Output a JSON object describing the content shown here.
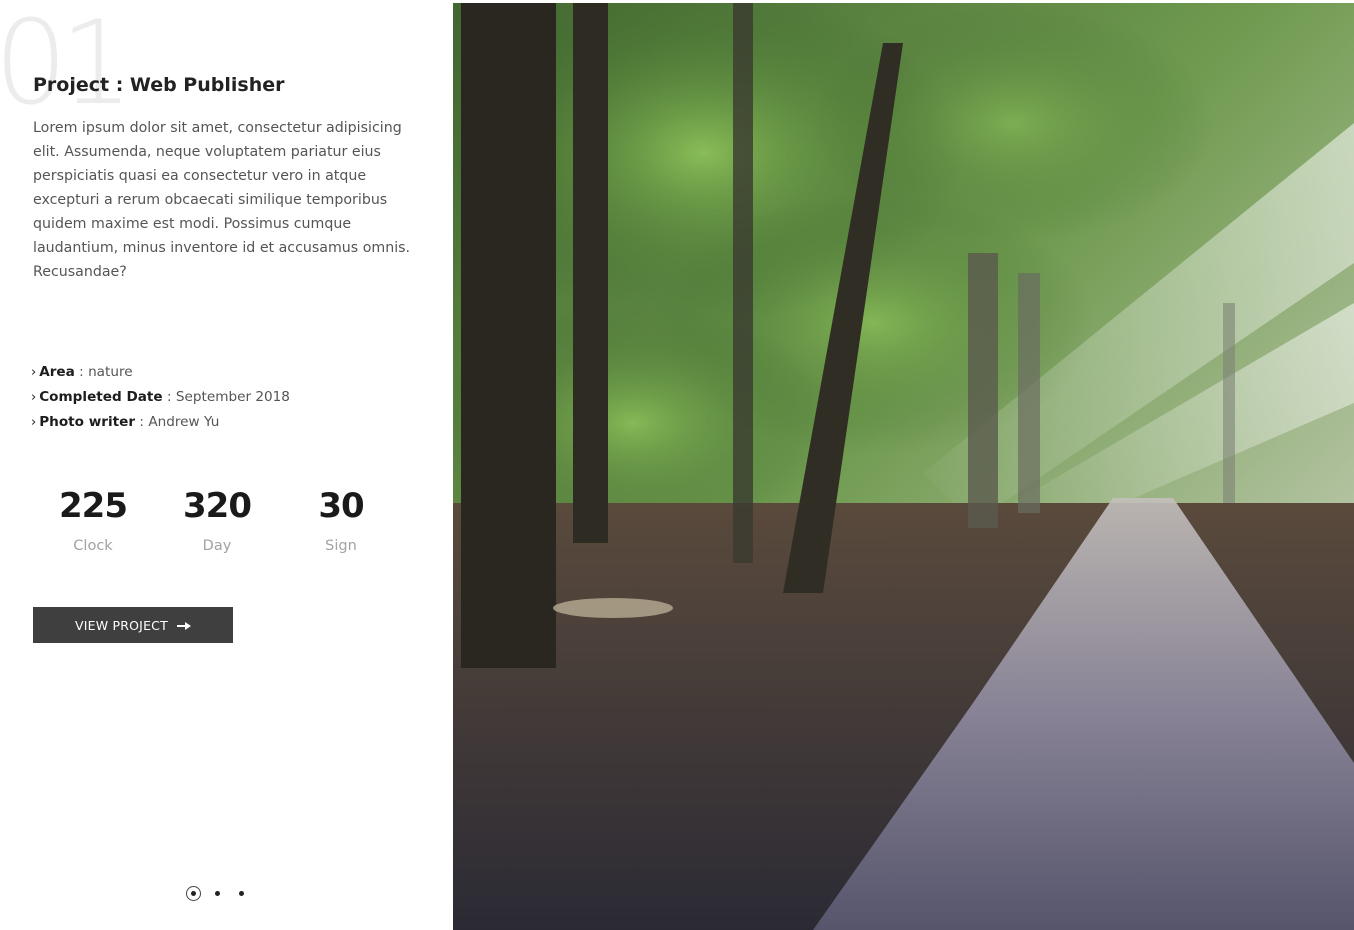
{
  "project": {
    "number": "01",
    "title": "Project : Web Publisher",
    "description": "Lorem ipsum dolor sit amet, consectetur adipisicing elit. Assumenda, neque voluptatem pariatur eius perspiciatis quasi ea consectetur vero in atque excepturi a rerum obcaecati similique temporibus quidem maxime est modi. Possimus cumque laudantium, minus inventore id et accusamus omnis. Recusandae?"
  },
  "meta": [
    {
      "label": "Area",
      "separator": " : ",
      "value": "nature"
    },
    {
      "label": "Completed Date",
      "separator": " : ",
      "value": "September 2018"
    },
    {
      "label": "Photo writer",
      "separator": " : ",
      "value": "Andrew Yu"
    }
  ],
  "stats": [
    {
      "value": "225",
      "label": "Clock"
    },
    {
      "value": "320",
      "label": "Day"
    },
    {
      "value": "30",
      "label": "Sign"
    }
  ],
  "button": {
    "label": "VIEW PROJECT",
    "icon": "arrow-right-icon"
  },
  "pager": {
    "count": 3,
    "active_index": 0
  },
  "colors": {
    "button_bg": "#3f3f3f",
    "stat_label": "#a2a2a2",
    "slide_number": "#ececec"
  }
}
